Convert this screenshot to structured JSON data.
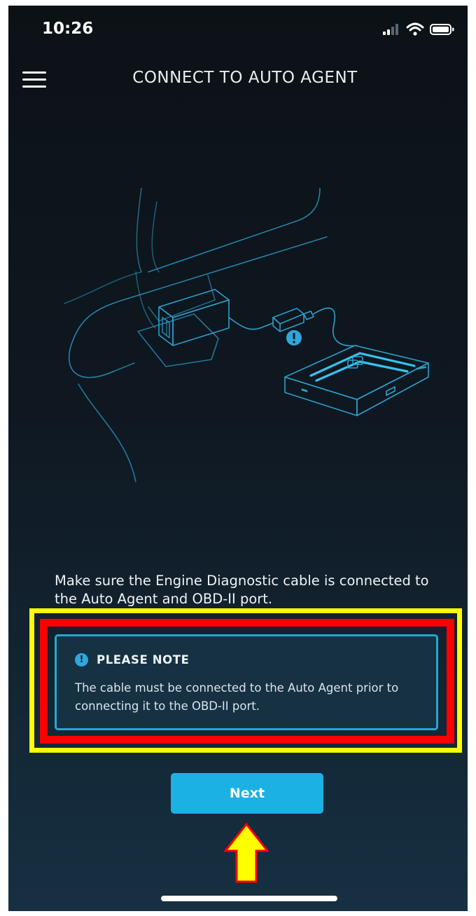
{
  "status_bar": {
    "time": "10:26"
  },
  "header": {
    "title": "CONNECT TO AUTO AGENT"
  },
  "instruction": {
    "text": "Make sure the Engine Diagnostic cable is connected to the Auto Agent and OBD-II port."
  },
  "note": {
    "title": "PLEASE NOTE",
    "body": "The cable must be connected to the Auto Agent prior to connecting it to the OBD-II port."
  },
  "actions": {
    "next_label": "Next"
  },
  "colors": {
    "accent": "#1bb1e2",
    "note_border": "#26a7d1",
    "highlight_yellow": "#ffff00",
    "highlight_red": "#ff0000"
  },
  "icons": [
    "menu-icon",
    "signal-icon",
    "wifi-icon",
    "battery-icon",
    "info-icon",
    "up-arrow-icon"
  ]
}
